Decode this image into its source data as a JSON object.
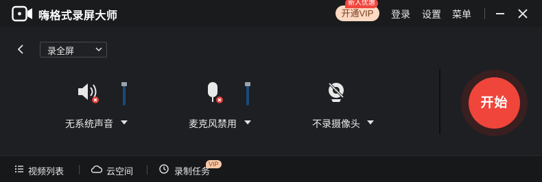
{
  "app": {
    "title": "嗨格式录屏大师"
  },
  "titlebar": {
    "vip_label": "开通VIP",
    "new_badge": "新人优惠",
    "login": "登录",
    "settings": "设置",
    "menu": "菜单",
    "icons": [
      "camera-logo-icon",
      "minimize-icon",
      "close-icon"
    ]
  },
  "toolbar": {
    "mode_value": "录全屏"
  },
  "devices": {
    "system_audio": {
      "label": "无系统声音",
      "icon": "speaker-muted-icon",
      "volume": 1.0
    },
    "microphone": {
      "label": "麦克风禁用",
      "icon": "microphone-muted-icon",
      "volume": 1.0
    },
    "camera": {
      "label": "不录摄像头",
      "icon": "camera-off-icon"
    }
  },
  "start": {
    "label": "开始"
  },
  "bottombar": {
    "video_list": "视频列表",
    "cloud_space": "云空间",
    "record_task": "录制任务",
    "vip_tag": "VIP"
  },
  "colors": {
    "accent": "#f0453b",
    "vip_bg": "#fbd9c2",
    "background": "#1e1f22"
  }
}
